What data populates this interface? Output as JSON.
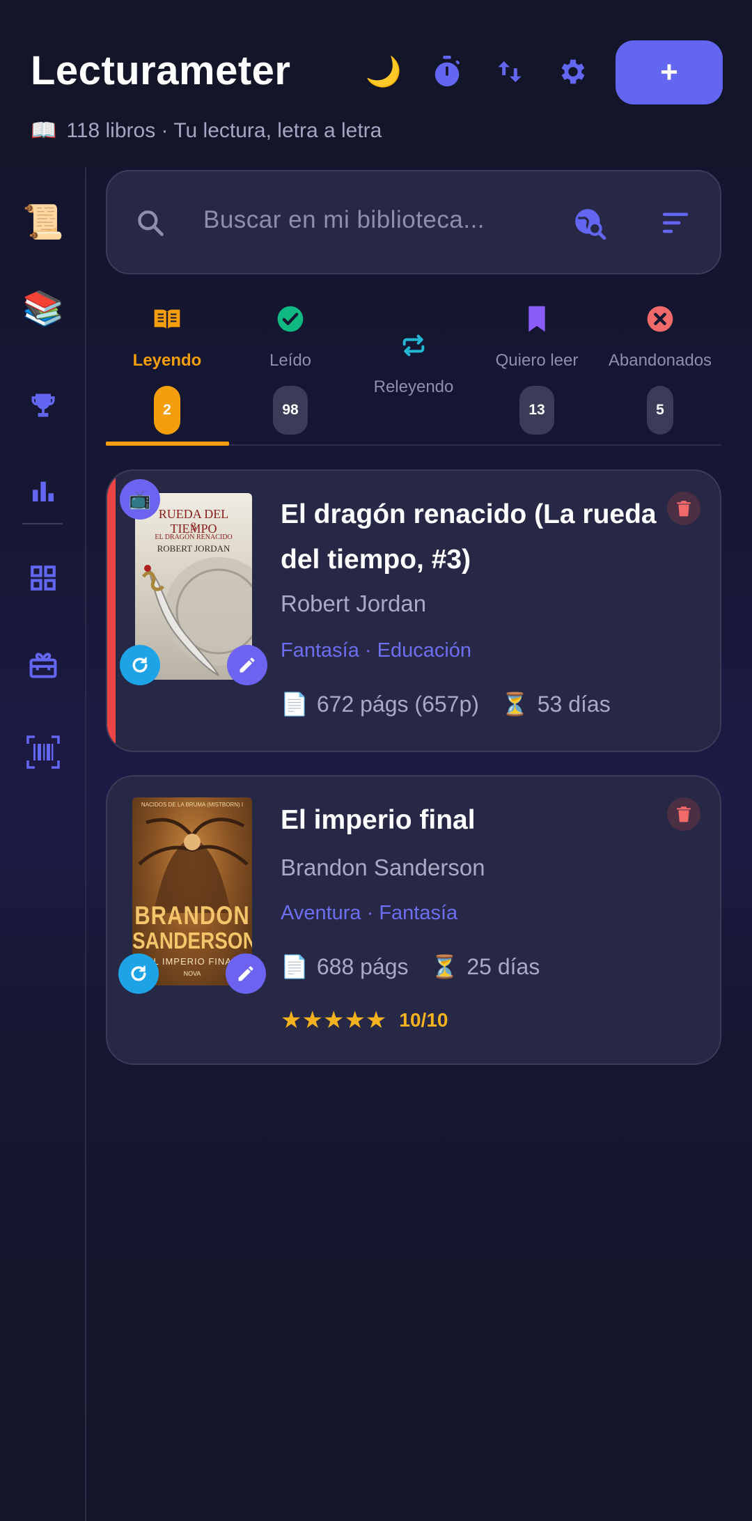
{
  "header": {
    "title": "Lecturameter",
    "subtitle_icon": "📖",
    "subtitle": "118 libros · Tu lectura, letra a letra",
    "icons": [
      "moon-icon",
      "stopwatch-icon",
      "swap-vertical-icon",
      "gear-icon"
    ],
    "moon_glyph": "🌙",
    "add_label": "+"
  },
  "sidebar": {
    "items": [
      {
        "name": "scroll-icon",
        "glyph": "📜"
      },
      {
        "name": "books-icon",
        "glyph": "📚"
      },
      {
        "name": "trophy-icon"
      },
      {
        "name": "bar-chart-icon"
      },
      {
        "name": "grid-icon"
      },
      {
        "name": "gift-icon"
      },
      {
        "name": "barcode-scan-icon"
      }
    ]
  },
  "search": {
    "placeholder": "Buscar en mi biblioteca..."
  },
  "tabs": [
    {
      "label": "Leyendo",
      "count": "2",
      "active": true,
      "icon": "open-book-icon"
    },
    {
      "label": "Leído",
      "count": "98",
      "active": false,
      "icon": "check-circle-icon"
    },
    {
      "label": "Releyendo",
      "count": "",
      "active": false,
      "icon": "repeat-icon"
    },
    {
      "label": "Quiero leer",
      "count": "13",
      "active": false,
      "icon": "bookmark-icon"
    },
    {
      "label": "Abandonados",
      "count": "5",
      "active": false,
      "icon": "x-circle-icon"
    }
  ],
  "books": [
    {
      "title": "El dragón renacido (La rueda del tiempo, #3)",
      "author": "Robert Jordan",
      "genres": "Fantasía · Educación",
      "pages_icon": "📄",
      "pages": "672 págs (657p)",
      "days_icon": "⏳",
      "days": "53 días",
      "badge_icon": "📺",
      "cover": {
        "line1": "RUEDA DEL TIEMPO",
        "line2": "3",
        "line3": "EL DRAGÓN RENACIDO",
        "line4": "ROBERT JORDAN"
      }
    },
    {
      "title": "El imperio final",
      "author": "Brandon Sanderson",
      "genres": "Aventura · Fantasía",
      "pages_icon": "📄",
      "pages": "688 págs",
      "days_icon": "⏳",
      "days": "25 días",
      "stars": "★★★★★",
      "rating": "10/10",
      "cover": {
        "line0": "NACIDOS DE LA BRUMA (MISTBORN) I",
        "line1": "BRANDON",
        "line2": "SANDERSON",
        "line3": "EL IMPERIO FINAL",
        "line4": "NOVA"
      }
    }
  ],
  "colors": {
    "accent": "#6366f1",
    "active_tab": "#f59e0b",
    "reading_bar": "#ef4444",
    "refresh_button": "#1ea3e6",
    "edit_button": "#6c63f0"
  }
}
